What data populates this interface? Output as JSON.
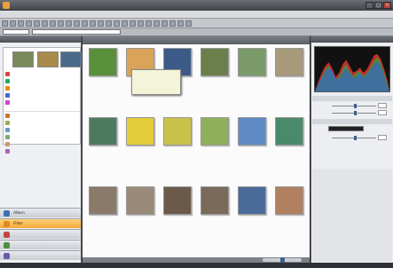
{
  "nav_pane": {
    "items": [
      {
        "label": "Alben",
        "color": "#3b6fb6"
      },
      {
        "label": "Filter",
        "color": "#e08a1e"
      },
      {
        "label": "",
        "color": "#c64545"
      },
      {
        "label": "",
        "color": "#4f8f3f"
      },
      {
        "label": "",
        "color": "#6a5aa8"
      }
    ]
  },
  "favorites": {
    "items": [
      {
        "label": "",
        "color": "#d44"
      },
      {
        "label": "",
        "color": "#2a6"
      },
      {
        "label": "",
        "color": "#e80"
      },
      {
        "label": "",
        "color": "#46c"
      },
      {
        "label": "",
        "color": "#c4c"
      }
    ],
    "section": "",
    "folders": [
      {
        "label": "",
        "color": "#c73"
      },
      {
        "label": "",
        "color": "#9a5"
      },
      {
        "label": "",
        "color": "#69c"
      },
      {
        "label": "",
        "color": "#7a7"
      },
      {
        "label": "",
        "color": "#c96"
      },
      {
        "label": "",
        "color": "#a6a"
      },
      {
        "label": "",
        "color": "#b77"
      },
      {
        "label": "",
        "color": "#777"
      },
      {
        "label": "",
        "color": "#5ab"
      },
      {
        "label": "",
        "color": "#db6"
      },
      {
        "label": "",
        "color": "#88a"
      },
      {
        "label": "",
        "color": "#c88"
      },
      {
        "label": "",
        "color": "#8b8"
      }
    ]
  },
  "thumbnails": [
    {
      "color": "#5a8f3c"
    },
    {
      "color": "#d9a35a"
    },
    {
      "color": "#3b5a88"
    },
    {
      "color": "#6a7f4a"
    },
    {
      "color": "#7a9a6a"
    },
    {
      "color": "#a89a7a"
    },
    {
      "color": "#4d7a5e"
    },
    {
      "color": "#e3cc3a"
    },
    {
      "color": "#c9c24a"
    },
    {
      "color": "#8fb05a"
    },
    {
      "color": "#5e8bc4"
    },
    {
      "color": "#4a8a6a"
    },
    {
      "color": "#8a7a6a"
    },
    {
      "color": "#9a8a7a"
    },
    {
      "color": "#6b5a4a"
    },
    {
      "color": "#7a6a5a"
    },
    {
      "color": "#4a6a9a"
    },
    {
      "color": "#b08060"
    }
  ],
  "right_sections": []
}
